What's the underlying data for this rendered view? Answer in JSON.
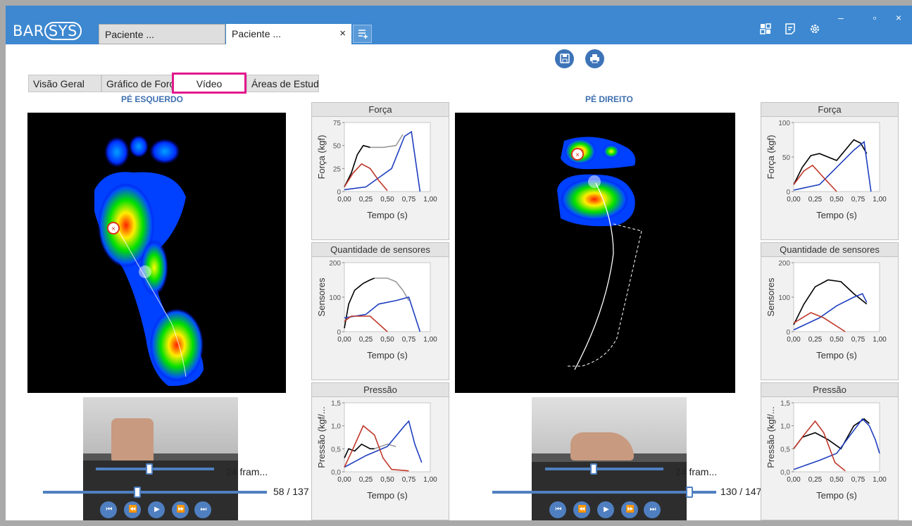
{
  "app": {
    "logo_left": "BAR",
    "logo_ring": "SYS",
    "tabs": [
      {
        "label": "Paciente ..."
      },
      {
        "label": "Paciente ...",
        "close": "×"
      }
    ],
    "new_tab_icon": "add-tab-icon",
    "header_icons": [
      "layout-icon",
      "notes-icon",
      "gear-icon"
    ],
    "window_buttons": {
      "minimize": "–",
      "maximize": "▫",
      "close": "×"
    }
  },
  "toolbar": {
    "save_icon": "save-icon",
    "print_icon": "print-icon"
  },
  "view_tabs": [
    {
      "label": "Visão Geral"
    },
    {
      "label": "Gráfico de Forç"
    },
    {
      "label": "Vídeo"
    },
    {
      "label": "Áreas de Estudo"
    }
  ],
  "left": {
    "title": "PÉ ESQUERDO",
    "frame_rate": "24 fram...",
    "frame_counter": "58 / 137",
    "frame_progress": 0.42,
    "rate_progress": 0.45
  },
  "right": {
    "title": "PÉ DIREITO",
    "frame_rate": "24 fram...",
    "frame_counter": "130 / 147",
    "frame_progress": 0.88,
    "rate_progress": 0.41
  },
  "colors": {
    "titlebar": "#3d88d0",
    "accent": "#4f7fc0",
    "highlight": "#e2188c",
    "total": "#000000",
    "heel": "#c0392b",
    "forefoot": "#1f3fbf"
  },
  "chart_data": [
    {
      "type": "line",
      "title": "Força",
      "xlabel": "Tempo (s)",
      "ylabel": "Força (kgf)",
      "ylim": [
        0,
        75
      ],
      "yticks": [
        "75",
        "50",
        "25",
        "0"
      ],
      "xticks": [
        "0,00",
        "0,25",
        "0,50",
        "0,75",
        "1,00"
      ],
      "series": [
        {
          "color": "#000000",
          "x": [
            0,
            0.08,
            0.15,
            0.22,
            0.3
          ],
          "y": [
            5,
            20,
            40,
            50,
            48
          ]
        },
        {
          "color": "#999999",
          "x": [
            0.3,
            0.45,
            0.6,
            0.68
          ],
          "y": [
            48,
            48,
            50,
            62
          ]
        },
        {
          "color": "#1f3fbf",
          "x": [
            0,
            0.25,
            0.4,
            0.55,
            0.7,
            0.78,
            0.88
          ],
          "y": [
            2,
            5,
            15,
            25,
            60,
            65,
            0
          ]
        },
        {
          "color": "#c0392b",
          "x": [
            0,
            0.1,
            0.2,
            0.3,
            0.4,
            0.5
          ],
          "y": [
            5,
            20,
            30,
            25,
            12,
            1
          ]
        }
      ]
    },
    {
      "type": "line",
      "title": "Quantidade de sensores",
      "xlabel": "Tempo (s)",
      "ylabel": "Sensores",
      "ylim": [
        0,
        200
      ],
      "yticks": [
        "200",
        "100",
        "0"
      ],
      "xticks": [
        "0,00",
        "0,25",
        "0,50",
        "0,75",
        "1,00"
      ],
      "series": [
        {
          "color": "#000000",
          "x": [
            0,
            0.05,
            0.12,
            0.22,
            0.3,
            0.35
          ],
          "y": [
            10,
            80,
            120,
            140,
            150,
            155
          ]
        },
        {
          "color": "#999999",
          "x": [
            0.35,
            0.5,
            0.6,
            0.68,
            0.75
          ],
          "y": [
            155,
            155,
            145,
            120,
            90
          ]
        },
        {
          "color": "#1f3fbf",
          "x": [
            0,
            0.25,
            0.4,
            0.6,
            0.75,
            0.88
          ],
          "y": [
            40,
            50,
            80,
            90,
            100,
            0
          ]
        },
        {
          "color": "#c0392b",
          "x": [
            0,
            0.08,
            0.3,
            0.5
          ],
          "y": [
            30,
            45,
            45,
            0
          ]
        }
      ]
    },
    {
      "type": "line",
      "title": "Pressão",
      "xlabel": "Tempo (s)",
      "ylabel": "Pressão (kgf/...",
      "ylim": [
        0,
        1.5
      ],
      "yticks": [
        "1,5",
        "1,0",
        "0,5",
        "0,0"
      ],
      "xticks": [
        "0,00",
        "0,25",
        "0,50",
        "0,75",
        "1,00"
      ],
      "series": [
        {
          "color": "#000000",
          "x": [
            0,
            0.05,
            0.12,
            0.2,
            0.3,
            0.35
          ],
          "y": [
            0.3,
            0.5,
            0.45,
            0.6,
            0.5,
            0.5
          ]
        },
        {
          "color": "#999999",
          "x": [
            0.35,
            0.5,
            0.6
          ],
          "y": [
            0.5,
            0.6,
            0.55
          ]
        },
        {
          "color": "#1f3fbf",
          "x": [
            0,
            0.25,
            0.5,
            0.7,
            0.75,
            0.82,
            0.9
          ],
          "y": [
            0.1,
            0.35,
            0.55,
            1.0,
            1.1,
            0.6,
            0.2
          ]
        },
        {
          "color": "#c0392b",
          "x": [
            0,
            0.1,
            0.22,
            0.35,
            0.45,
            0.55,
            0.75
          ],
          "y": [
            0.1,
            0.5,
            1.0,
            0.8,
            0.3,
            0.05,
            0.02
          ]
        }
      ]
    },
    {
      "type": "line",
      "title": "Força",
      "xlabel": "Tempo (s)",
      "ylabel": "Força (kgf)",
      "ylim": [
        0,
        100
      ],
      "yticks": [
        "100",
        "50",
        "0"
      ],
      "xticks": [
        "0,00",
        "0,25",
        "0,50",
        "0,75",
        "1,00"
      ],
      "series": [
        {
          "color": "#000000",
          "x": [
            0,
            0.1,
            0.2,
            0.3,
            0.5,
            0.7,
            0.78,
            0.85
          ],
          "y": [
            10,
            35,
            52,
            55,
            45,
            75,
            70,
            55
          ]
        },
        {
          "color": "#1f3fbf",
          "x": [
            0,
            0.3,
            0.5,
            0.7,
            0.82,
            0.9
          ],
          "y": [
            2,
            10,
            35,
            60,
            72,
            0
          ]
        },
        {
          "color": "#c0392b",
          "x": [
            0,
            0.12,
            0.22,
            0.35,
            0.5
          ],
          "y": [
            10,
            30,
            38,
            20,
            0
          ]
        }
      ]
    },
    {
      "type": "line",
      "title": "Quantidade de sensores",
      "xlabel": "Tempo (s)",
      "ylabel": "Sensores",
      "ylim": [
        0,
        200
      ],
      "yticks": [
        "200",
        "100",
        "0"
      ],
      "xticks": [
        "0,00",
        "0,25",
        "0,50",
        "0,75",
        "1,00"
      ],
      "series": [
        {
          "color": "#000000",
          "x": [
            0,
            0.12,
            0.25,
            0.4,
            0.55,
            0.7,
            0.85
          ],
          "y": [
            20,
            80,
            130,
            150,
            145,
            110,
            80
          ]
        },
        {
          "color": "#1f3fbf",
          "x": [
            0,
            0.3,
            0.5,
            0.7,
            0.8,
            0.85
          ],
          "y": [
            5,
            40,
            75,
            100,
            110,
            85
          ]
        },
        {
          "color": "#c0392b",
          "x": [
            0,
            0.2,
            0.35,
            0.6
          ],
          "y": [
            25,
            55,
            40,
            0
          ]
        }
      ]
    },
    {
      "type": "line",
      "title": "Pressão",
      "xlabel": "Tempo (s)",
      "ylabel": "Pressão (kgf/...",
      "ylim": [
        0,
        1.5
      ],
      "yticks": [
        "1,5",
        "1,0",
        "0,5",
        "0,0"
      ],
      "xticks": [
        "0,00",
        "0,25",
        "0,50",
        "0,75",
        "1,00"
      ],
      "series": [
        {
          "color": "#000000",
          "x": [
            0,
            0.1,
            0.25,
            0.4,
            0.55,
            0.7,
            0.82,
            0.88
          ],
          "y": [
            0.5,
            0.75,
            0.85,
            0.7,
            0.5,
            1.0,
            1.15,
            1.05
          ]
        },
        {
          "color": "#1f3fbf",
          "x": [
            0,
            0.3,
            0.5,
            0.7,
            0.8,
            0.88,
            0.95,
            1.0
          ],
          "y": [
            0.05,
            0.25,
            0.4,
            0.9,
            1.15,
            1.0,
            0.7,
            0.4
          ]
        },
        {
          "color": "#c0392b",
          "x": [
            0,
            0.12,
            0.25,
            0.35,
            0.48,
            0.6
          ],
          "y": [
            0.5,
            0.8,
            1.1,
            0.85,
            0.2,
            0.02
          ]
        }
      ]
    }
  ]
}
